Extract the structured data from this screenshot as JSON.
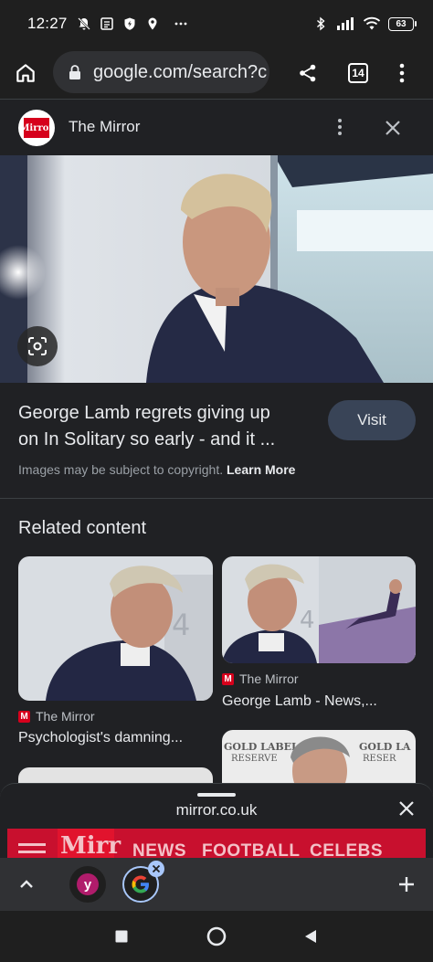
{
  "status_bar": {
    "time": "12:27",
    "battery": "63",
    "icons": [
      "mute-notification-icon",
      "news-icon",
      "shield-icon",
      "location-icon",
      "more-dots-icon",
      "bluetooth-icon",
      "signal-icon",
      "wifi-icon",
      "battery-icon"
    ]
  },
  "toolbar": {
    "url": "google.com/search?c",
    "tab_count": "14",
    "icons": [
      "home-icon",
      "lock-icon",
      "share-icon",
      "menu-dots-icon"
    ]
  },
  "source": {
    "logo_text": "Mirror",
    "name": "The Mirror"
  },
  "result": {
    "title_line1": "George Lamb regrets giving up",
    "title_line2": "on In Solitary so early - and it ...",
    "visit_label": "Visit",
    "copyright_text": "Images may be subject to copyright.",
    "learn_more": "Learn More"
  },
  "related": {
    "heading": "Related content",
    "cards": [
      {
        "source": "The Mirror",
        "title": "Psychologist's damning..."
      },
      {
        "source": "The Mirror",
        "title": "George Lamb - News,..."
      }
    ],
    "card3_text": "GOLD LABEL RESERVE"
  },
  "sheet": {
    "url": "mirror.co.uk",
    "preview_logo": "Mirr",
    "preview_nav": [
      "NEWS",
      "FOOTBALL",
      "CELEBS"
    ]
  },
  "colors": {
    "background": "#202124",
    "visit_button": "#394457",
    "mirror_red": "#d6001c"
  }
}
